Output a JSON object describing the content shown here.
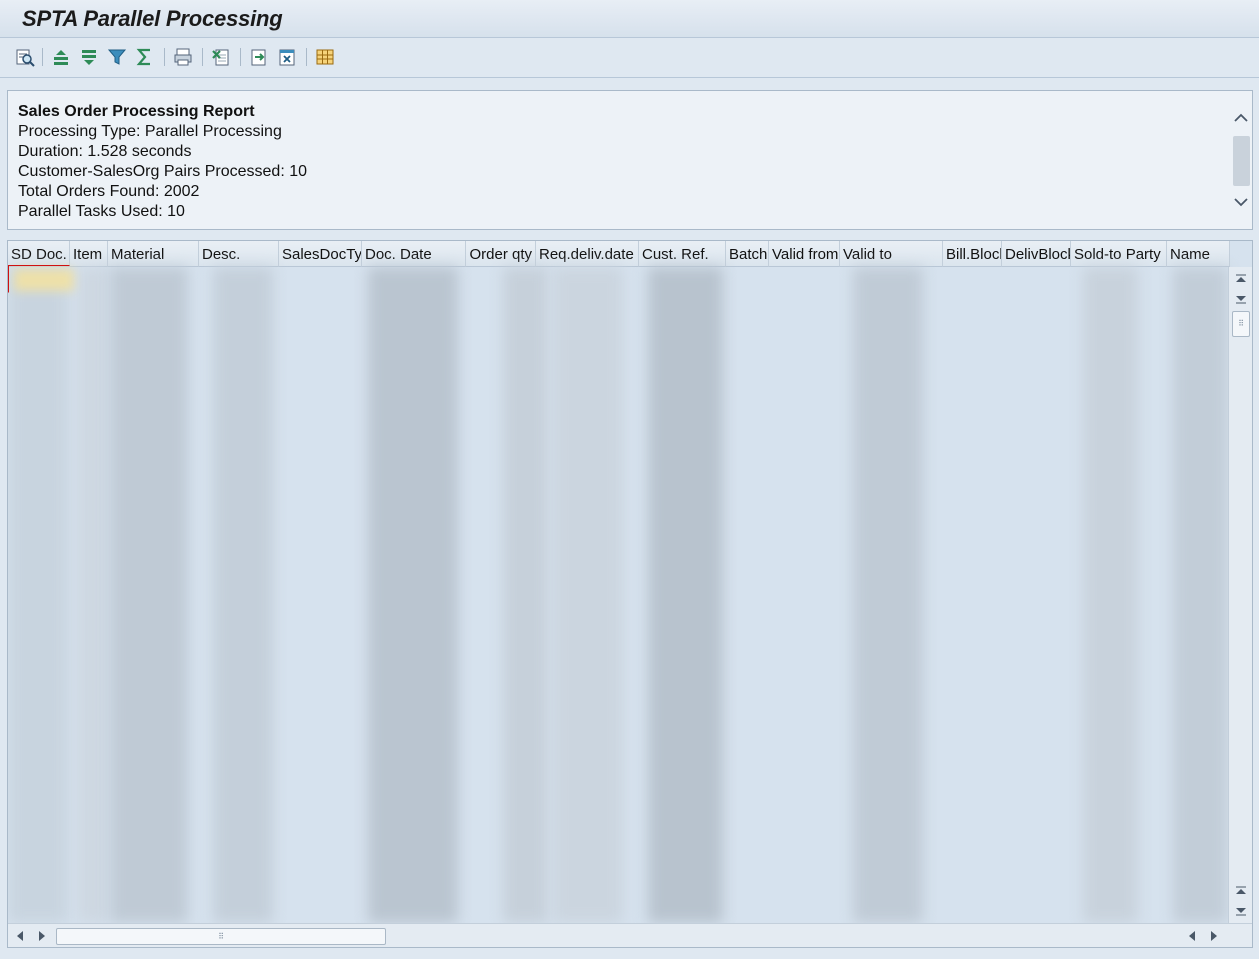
{
  "window": {
    "title": "SPTA Parallel Processing"
  },
  "toolbar": {
    "buttons": [
      {
        "name": "details-icon"
      },
      {
        "name": "sort-ascending-icon"
      },
      {
        "name": "sort-descending-icon"
      },
      {
        "name": "filter-icon"
      },
      {
        "name": "total-icon"
      },
      {
        "name": "print-preview-icon"
      },
      {
        "name": "export-spreadsheet-icon"
      },
      {
        "name": "export-icon"
      },
      {
        "name": "export-file-icon"
      },
      {
        "name": "layout-icon"
      }
    ]
  },
  "report": {
    "heading": "Sales Order Processing Report",
    "lines": [
      "Processing Type: Parallel Processing",
      "Duration: 1.528 seconds",
      "Customer-SalesOrg Pairs Processed: 10",
      "Total Orders Found: 2002",
      "Parallel Tasks Used: 10"
    ]
  },
  "grid": {
    "columns": [
      {
        "label": "SD Doc."
      },
      {
        "label": "Item"
      },
      {
        "label": "Material"
      },
      {
        "label": "Desc."
      },
      {
        "label": "SalesDocTy"
      },
      {
        "label": "Doc. Date"
      },
      {
        "label": "Order qty"
      },
      {
        "label": "Req.deliv.date"
      },
      {
        "label": "Cust. Ref."
      },
      {
        "label": "Batch"
      },
      {
        "label": "Valid from"
      },
      {
        "label": "Valid to"
      },
      {
        "label": "Bill.Block"
      },
      {
        "label": "DelivBlock"
      },
      {
        "label": "Sold-to Party"
      },
      {
        "label": "Name"
      }
    ]
  },
  "colors": {
    "background": "#dfe8f1",
    "panel": "#edf2f7",
    "grid": "#d6e2ee",
    "accent_green": "#2e8b57",
    "selection": "#d01010"
  }
}
